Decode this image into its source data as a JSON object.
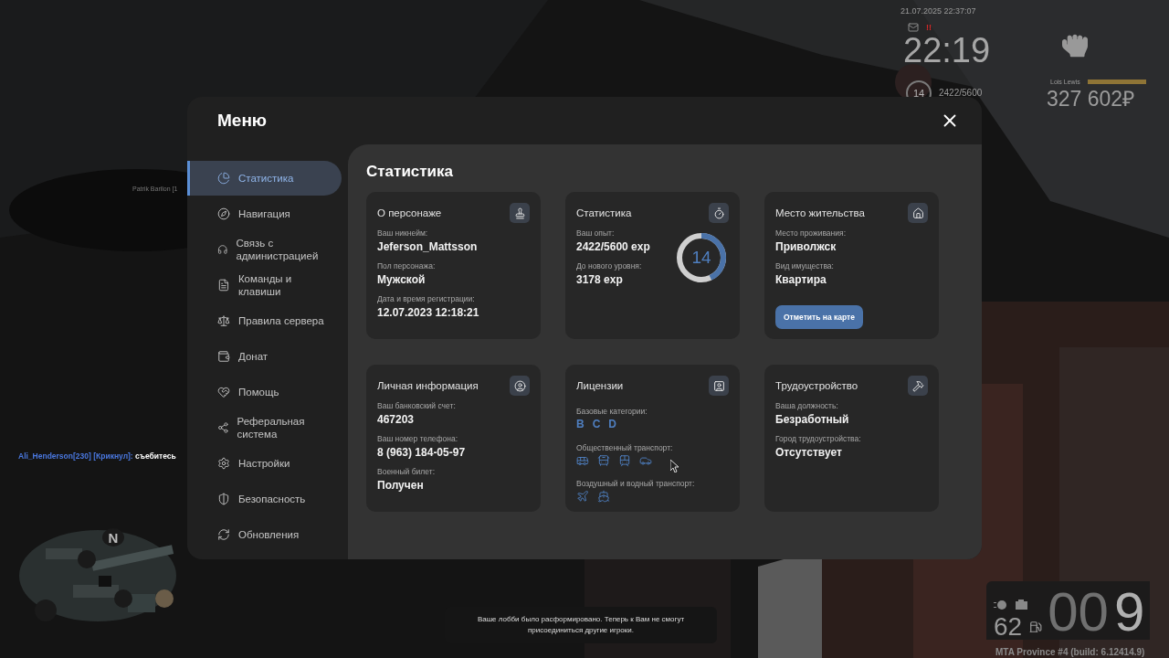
{
  "hud": {
    "date": "21.07.2025 22:37:07",
    "alert": "!!",
    "clock": "22:19",
    "level": "14",
    "exp": "2422/5600",
    "player_name": "Lois Lewis",
    "status_bar": {
      "level": 1
    },
    "money": "327 602₽",
    "nametag": "Patrik Barilon [1",
    "speed": "62",
    "odometer_dim": "00",
    "odometer": "9"
  },
  "chat": [
    {
      "sender": "Ali_Henderson[230] [Крикнул]:",
      "message": "съебитесь"
    }
  ],
  "minimap": {
    "north": "N"
  },
  "notification": "Ваше лобби было расформировано. Теперь к Вам не смогут присоединиться другие игроки.",
  "build": "MTA Province #4 (build: 6.12414.9)",
  "menu": {
    "title": "Меню",
    "sidebar": [
      {
        "label": "Статистика",
        "selected": true
      },
      {
        "label": "Навигация",
        "selected": false
      },
      {
        "label": "Связь с администрацией",
        "selected": false
      },
      {
        "label": "Команды и клавиши",
        "selected": false
      },
      {
        "label": "Правила сервера",
        "selected": false
      },
      {
        "label": "Донат",
        "selected": false
      },
      {
        "label": "Помощь",
        "selected": false
      },
      {
        "label": "Реферальная система",
        "selected": false
      },
      {
        "label": "Настройки",
        "selected": false
      },
      {
        "label": "Безопасность",
        "selected": false
      },
      {
        "label": "Обновления",
        "selected": false
      }
    ],
    "page_title": "Статистика",
    "cards": [
      {
        "kind": "info",
        "title": "О персонаже",
        "fields": [
          {
            "label": "Ваш никнейм:",
            "value": "Jeferson_Mattsson"
          },
          {
            "label": "Пол персонажа:",
            "value": "Мужской"
          },
          {
            "label": "Дата и время регистрации:",
            "value": "12.07.2023 12:18:21"
          }
        ]
      },
      {
        "kind": "experience",
        "title": "Статистика",
        "fields": [
          {
            "label": "Ваш опыт:",
            "value": "2422/5600 exp"
          },
          {
            "label": "До нового уровня:",
            "value": "3178 exp"
          }
        ],
        "ring": {
          "value": "14",
          "level": 0.4325
        }
      },
      {
        "kind": "info",
        "title": "Место жительства",
        "fields": [
          {
            "label": "Место проживания:",
            "value": "Приволжск"
          },
          {
            "label": "Вид имущества:",
            "value": "Квартира"
          }
        ],
        "button": "Отметить на карте"
      },
      {
        "kind": "info",
        "title": "Личная информация",
        "fields": [
          {
            "label": "Ваш банковский счет:",
            "value": "467203"
          },
          {
            "label": "Ваш номер телефона:",
            "value": "8 (963) 184-05-97"
          },
          {
            "label": "Военный билет:",
            "value": "Получен"
          }
        ]
      },
      {
        "kind": "licenses",
        "title": "Лицензии",
        "groups": [
          {
            "kind": "letters",
            "label": "Базовые категории:",
            "letters": [
              "B",
              "C",
              "D"
            ]
          },
          {
            "kind": "vehicles",
            "label": "Общественный транспорт:"
          },
          {
            "kind": "vehicles",
            "label": "Воздушный и водный транспорт:"
          }
        ]
      },
      {
        "kind": "info",
        "title": "Трудоустройство",
        "fields": [
          {
            "label": "Ваша должность:",
            "value": "Безработный"
          },
          {
            "label": "Город трудоустройства:",
            "value": "Отсутствует"
          }
        ]
      }
    ]
  }
}
